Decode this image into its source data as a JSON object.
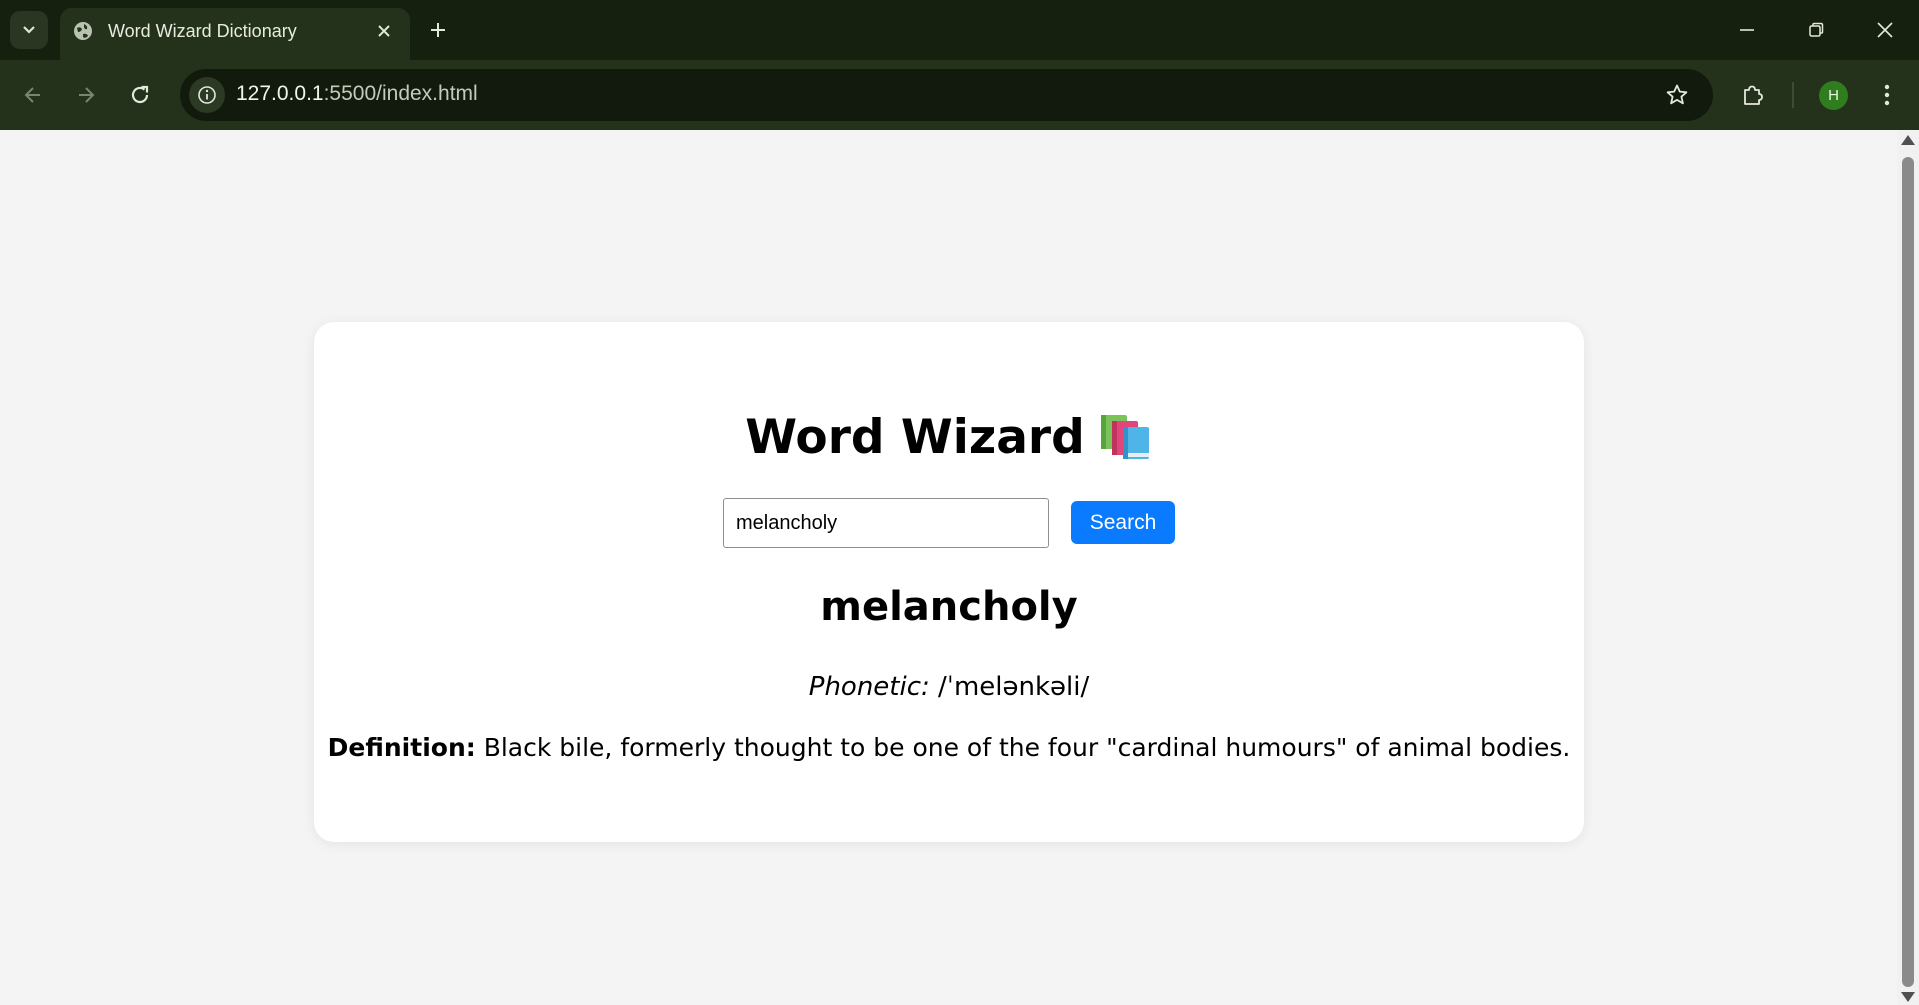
{
  "browser": {
    "tab_title": "Word Wizard Dictionary",
    "url_host": "127.0.0.1",
    "url_rest": ":5500/index.html",
    "avatar_initial": "H",
    "icons": {
      "tab_list": "chevron-down-icon",
      "tab_favicon": "globe-icon",
      "tab_close": "close-icon",
      "new_tab": "plus-icon",
      "minimize": "minimize-icon",
      "restore": "restore-icon",
      "close_window": "close-icon",
      "back": "arrow-left-icon",
      "forward": "arrow-right-icon",
      "reload": "reload-icon",
      "site_info": "info-icon",
      "bookmark": "star-icon",
      "extensions": "puzzle-icon",
      "menu": "kebab-menu-icon"
    },
    "colors": {
      "titlebar": "#16200f",
      "toolbar": "#24321b",
      "avatar": "#2f7d1f"
    }
  },
  "app": {
    "title": "Word Wizard",
    "title_icon": "books-icon",
    "search": {
      "value": "melancholy",
      "placeholder": "",
      "button_label": "Search"
    },
    "result": {
      "word": "melancholy",
      "phonetic_label": "Phonetic:",
      "phonetic_value": " /ˈmelənkəli/",
      "definition_label": "Definition:",
      "definition_value": " Black bile, formerly thought to be one of the four \"cardinal humours\" of animal bodies."
    },
    "colors": {
      "page_background": "#f4f4f4",
      "card_background": "#ffffff",
      "button": "#0a7bff"
    }
  }
}
